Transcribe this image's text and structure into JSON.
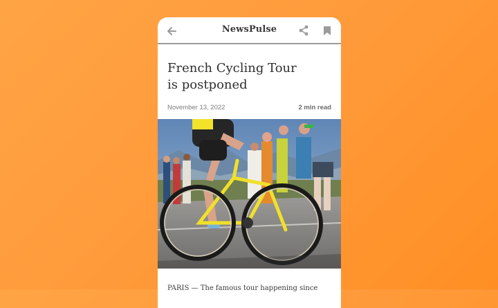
{
  "app": {
    "title": "NewsPulse",
    "icons": {
      "back": "arrow-left-icon",
      "share": "share-icon",
      "bookmark": "bookmark-icon"
    }
  },
  "article": {
    "headline_line1": "French Cycling Tour",
    "headline_line2": "is postponed",
    "date": "November 13, 2022",
    "read_time": "2 min read",
    "image_alt": "Cyclist racing uphill past cheering spectators",
    "body_start": "PARIS — The famous tour happening since"
  },
  "colors": {
    "background": "#ff9a3a",
    "card": "#ffffff",
    "icon_gray": "#9b9b9b",
    "divider": "#9b9b9b",
    "headline": "#2f2f2f"
  }
}
